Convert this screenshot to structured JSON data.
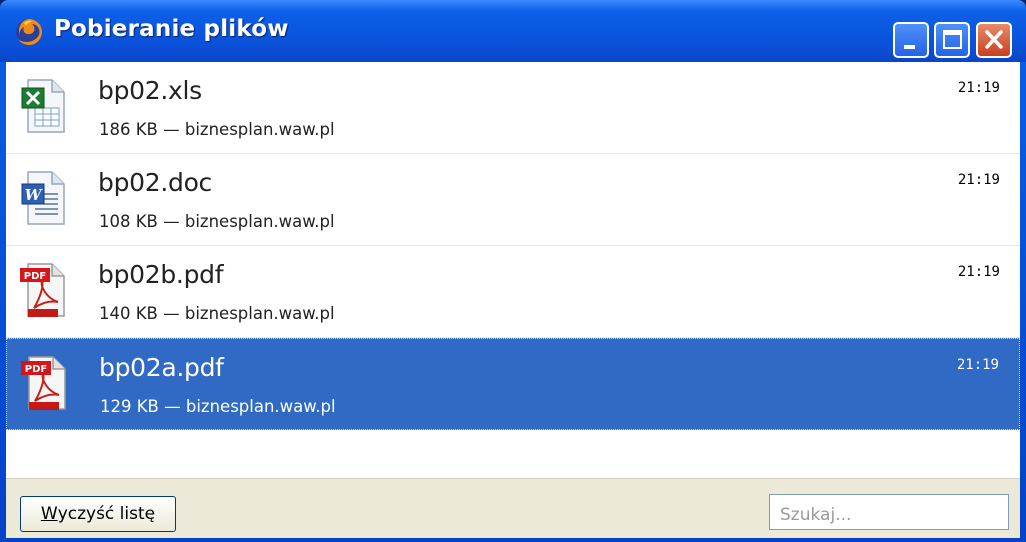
{
  "window": {
    "title": "Pobieranie plików"
  },
  "downloads": [
    {
      "name": "bp02.xls",
      "meta": "186 KB — biznesplan.waw.pl",
      "time": "21:19",
      "icon": "excel-document-icon"
    },
    {
      "name": "bp02.doc",
      "meta": "108 KB — biznesplan.waw.pl",
      "time": "21:19",
      "icon": "word-document-icon"
    },
    {
      "name": "bp02b.pdf",
      "meta": "140 KB — biznesplan.waw.pl",
      "time": "21:19",
      "icon": "pdf-document-icon"
    },
    {
      "name": "bp02a.pdf",
      "meta": "129 KB — biznesplan.waw.pl",
      "time": "21:19",
      "icon": "pdf-document-icon",
      "selected": true
    }
  ],
  "footer": {
    "clear_label_first": "W",
    "clear_label_rest": "yczyść listę",
    "search_placeholder": "Szukaj..."
  },
  "colors": {
    "titlebar": "#0a57e0",
    "selection": "#316ac5",
    "footer": "#ece9d8"
  }
}
